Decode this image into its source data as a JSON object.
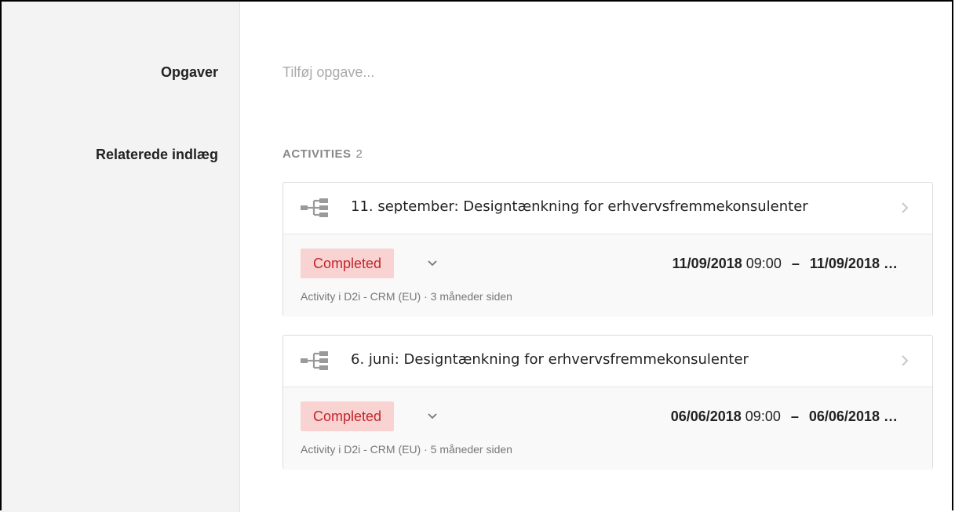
{
  "fields": {
    "tasks_label": "Opgaver",
    "tasks_placeholder": "Tilføj opgave...",
    "related_label": "Relaterede indlæg"
  },
  "activities": {
    "heading": "ACTIVITIES",
    "count": "2",
    "items": [
      {
        "title": "11. september: Designtænkning for erhvervsfremmekonsulenter",
        "status": "Completed",
        "start_date": "11/09/2018",
        "start_time": "09:00",
        "separator": "–",
        "end_date": "11/09/2018",
        "ellipsis": "…",
        "meta": "Activity i D2i - CRM (EU) · 3 måneder siden"
      },
      {
        "title": "6. juni: Designtænkning for erhvervsfremmekonsulenter",
        "status": "Completed",
        "start_date": "06/06/2018",
        "start_time": "09:00",
        "separator": "–",
        "end_date": "06/06/2018",
        "ellipsis": "…",
        "meta": "Activity i D2i - CRM (EU) · 5 måneder siden"
      }
    ]
  },
  "colors": {
    "status_bg": "#f9d2d2",
    "status_text": "#c0262c",
    "sidebar_bg": "#f3f3f3",
    "icon_gray": "#9a9a9a"
  },
  "icons": {
    "activity": "hierarchy-icon",
    "open": "chevron-right-icon",
    "status_menu": "chevron-down-icon"
  }
}
